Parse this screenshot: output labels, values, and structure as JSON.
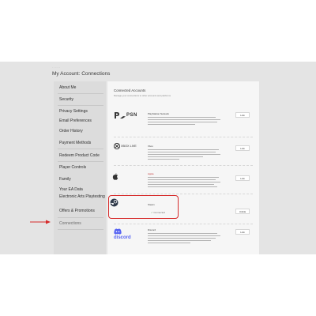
{
  "breadcrumb": "· · · · · ·",
  "page_title": "My Account: Connections",
  "sidebar": {
    "items": [
      {
        "label": "About Me"
      },
      {
        "label": "Security"
      },
      {
        "label": "Privacy Settings"
      },
      {
        "label": "Email Preferences"
      },
      {
        "label": "Order History"
      },
      {
        "label": "Payment Methods"
      },
      {
        "label": "Redeem Product Code"
      },
      {
        "label": "Player Controls"
      },
      {
        "label": "Family"
      },
      {
        "label": "Your EA Data"
      },
      {
        "label": "Electronic Arts Playtesting"
      },
      {
        "label": "Offers & Promotions"
      },
      {
        "label": "Connections"
      }
    ]
  },
  "content": {
    "title": "Connected Accounts",
    "subtitle": "Manage your connections to other accounts and platforms"
  },
  "services": [
    {
      "name": "PlayStation Network",
      "icon": "playstation-icon",
      "logo_text": "PSN",
      "action": "Link"
    },
    {
      "name": "Xbox",
      "icon": "xbox-icon",
      "logo_text": "XBOX LIVE",
      "action": "Link"
    },
    {
      "name": "Apple",
      "icon": "apple-icon",
      "logo_text": "",
      "action": "Link"
    },
    {
      "name": "Steam",
      "icon": "steam-icon",
      "logo_text": "",
      "action": "Unlink",
      "status": "Connected"
    },
    {
      "name": "Discord",
      "icon": "discord-icon",
      "logo_text": "discord",
      "action": "Link"
    }
  ],
  "colors": {
    "highlight": "#d62a2a",
    "discord": "#5865f2",
    "apple_name": "#c03030"
  }
}
